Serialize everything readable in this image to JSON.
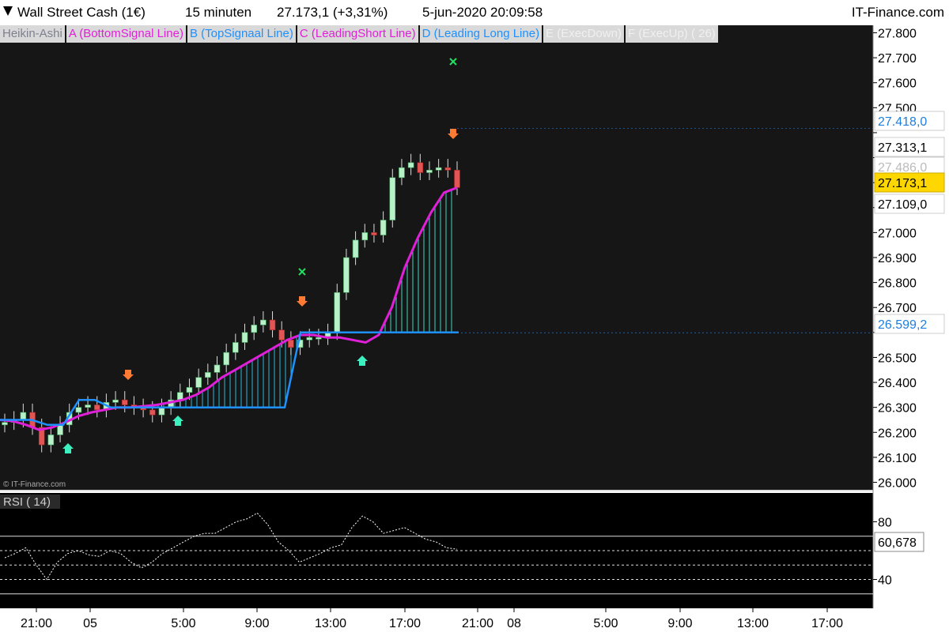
{
  "header": {
    "instrument": "Wall Street Cash (1€)",
    "timeframe": "15 minuten",
    "last_change": "27.173,1 (+3,31%)",
    "datetime": "5-jun-2020 20:09:58",
    "brand": "IT-Finance.com"
  },
  "legend": [
    {
      "label": "Heikin-Ashi",
      "color": "#7f7f8f"
    },
    {
      "label": "A (BottomSignal Line)",
      "color": "#e020d8"
    },
    {
      "label": "B (TopSignaal Line)",
      "color": "#1e90ff"
    },
    {
      "label": "C (LeadingShort Line)",
      "color": "#e020d8"
    },
    {
      "label": "D (Leading Long Line)",
      "color": "#1e90ff"
    },
    {
      "label": "E (ExecDown)",
      "color": "#f0f0f0"
    },
    {
      "label": "F (ExecUp) ( 26)",
      "color": "#f0f0f0"
    }
  ],
  "watermark": "© IT-Finance.com",
  "rsi_label": "RSI ( 14)",
  "price_badges": {
    "high": "27.418,0",
    "upper": "27.313,1",
    "hidden": "27.486,0",
    "last": "27.173,1",
    "lower": "27.109,0",
    "line": "26.599,2"
  },
  "rsi_badge": "60,678",
  "chart_data": [
    {
      "type": "line",
      "title": "Wall Street Cash (1€) 15 minuten",
      "ylim": [
        25970,
        27830
      ],
      "y_ticks": [
        26000,
        26100,
        26200,
        26300,
        26400,
        26500,
        26600,
        26700,
        26800,
        26900,
        27000,
        27100,
        27200,
        27300,
        27400,
        27500,
        27600,
        27700,
        27800
      ],
      "y_tick_labels": [
        "26.000",
        "26.100",
        "26.200",
        "26.300",
        "26.400",
        "26.500",
        "",
        "26.700",
        "26.800",
        "26.900",
        "27.000",
        "",
        "",
        "",
        "",
        "27.500",
        "27.600",
        "27.700",
        "27.800"
      ],
      "x_labels": [
        "21:00",
        "05",
        "5:00",
        "9:00",
        "13:00",
        "17:00",
        "21:00",
        "08",
        "5:00",
        "9:00",
        "13:00",
        "17:00"
      ],
      "series": [
        {
          "name": "Heikin-Ashi",
          "close": [
            26240,
            26250,
            26280,
            26220,
            26150,
            26190,
            26230,
            26280,
            26300,
            26310,
            26290,
            26320,
            26330,
            26310,
            26300,
            26290,
            26270,
            26300,
            26330,
            26360,
            26380,
            26420,
            26440,
            26470,
            26520,
            26560,
            26600,
            26630,
            26650,
            26610,
            26570,
            26540,
            26570,
            26580,
            26580,
            26600,
            26760,
            26900,
            26970,
            27000,
            26990,
            27050,
            27220,
            27260,
            27280,
            27240,
            27250,
            27260,
            27250,
            27180
          ]
        },
        {
          "name": "A (BottomSignal Line)",
          "values": [
            26250,
            26245,
            26230,
            26210,
            26220,
            26240,
            26265,
            26280,
            26290,
            26300,
            26300,
            26305,
            26310,
            26320,
            26330,
            26350,
            26380,
            26420,
            26450,
            26480,
            26510,
            26540,
            26570,
            26590,
            26590,
            26580,
            26580,
            26570,
            26560,
            26590,
            26700,
            26860,
            26980,
            27080,
            27160,
            27180
          ]
        },
        {
          "name": "B (TopSignaal Line)",
          "values": [
            26250,
            26250,
            26250,
            26230,
            26230,
            26330,
            26330,
            26300,
            26300,
            26300,
            26300,
            26300,
            26300,
            26300,
            26300,
            26300,
            26300,
            26300,
            26300,
            26600,
            26600,
            26600,
            26600,
            26600,
            26600,
            26600,
            26600,
            26600,
            26600,
            26600
          ]
        }
      ]
    },
    {
      "type": "line",
      "title": "RSI ( 14)",
      "ylim": [
        20,
        100
      ],
      "y_ticks": [
        80,
        40
      ],
      "levels": [
        70,
        60,
        50,
        40,
        30
      ],
      "series": [
        {
          "name": "RSI ( 14)",
          "values": [
            55,
            58,
            62,
            50,
            40,
            52,
            58,
            60,
            57,
            56,
            60,
            58,
            52,
            48,
            52,
            58,
            62,
            66,
            70,
            72,
            72,
            76,
            80,
            82,
            86,
            78,
            66,
            60,
            52,
            55,
            58,
            62,
            64,
            76,
            84,
            80,
            72,
            74,
            76,
            72,
            68,
            66,
            62,
            61
          ]
        }
      ]
    }
  ]
}
